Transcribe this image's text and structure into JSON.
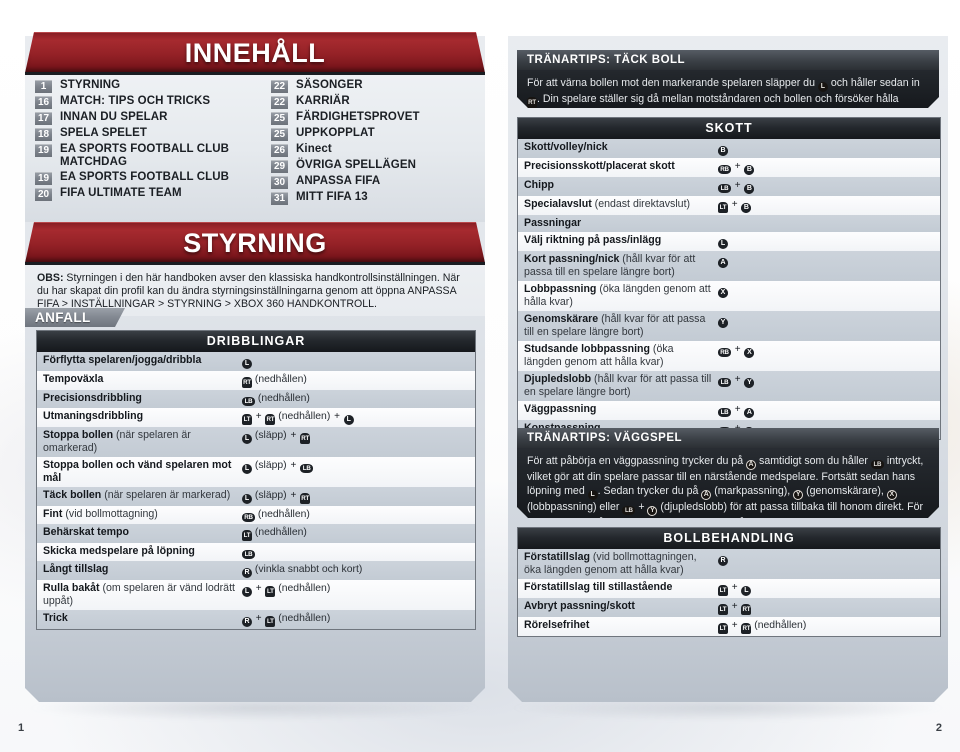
{
  "spread": {
    "page_number_left": "1",
    "page_number_right": "2"
  },
  "left_page": {
    "banner_toc": "INNEHÅLL",
    "banner_section": "STYRNING",
    "toc": {
      "left_column": [
        {
          "page": "1",
          "label": "STYRNING"
        },
        {
          "page": "16",
          "label": "MATCH: TIPS OCH TRICKS"
        },
        {
          "page": "17",
          "label": "INNAN DU SPELAR"
        },
        {
          "page": "18",
          "label": "SPELA SPELET"
        },
        {
          "page": "19",
          "label": "EA SPORTS FOOTBALL CLUB",
          "label2": "MATCHDAG"
        },
        {
          "page": "19",
          "label": "EA SPORTS FOOTBALL CLUB"
        },
        {
          "page": "20",
          "label": "FIFA ULTIMATE TEAM"
        }
      ],
      "right_column": [
        {
          "page": "22",
          "label": "SÄSONGER"
        },
        {
          "page": "22",
          "label": "KARRIÄR"
        },
        {
          "page": "25",
          "label": "FÄRDIGHETSPROVET"
        },
        {
          "page": "25",
          "label": "UPPKOPPLAT"
        },
        {
          "page": "26",
          "label": "Kinect"
        },
        {
          "page": "29",
          "label": "ÖVRIGA SPELLÄGEN"
        },
        {
          "page": "30",
          "label": "ANPASSA FIFA"
        },
        {
          "page": "31",
          "label": "MITT FIFA 13"
        }
      ]
    },
    "note": {
      "prefix": "OBS:",
      "text": " Styrningen i den här handboken avser den klassiska handkontrollsinställningen. När du har skapat din profil kan du ändra styrningsinställningarna genom att öppna ANPASSA FIFA > INSTÄLLNINGAR > STYRNING > XBOX 360 HANDKONTROLL."
    },
    "section_tab": "ANFALL",
    "table": {
      "header": "DRIBBLINGAR",
      "rows": [
        {
          "label": "Förflytta spelaren/jogga/dribbla",
          "note": "",
          "buttons": [
            {
              "t": "stick",
              "k": "L"
            }
          ]
        },
        {
          "label": "Tempoväxla",
          "note": "",
          "buttons": [
            {
              "t": "trigger",
              "k": "RT"
            },
            {
              "t": "text",
              "k": "(nedhållen)"
            }
          ]
        },
        {
          "label": "Precisionsdribbling",
          "note": "",
          "buttons": [
            {
              "t": "shoulder",
              "k": "LB"
            },
            {
              "t": "text",
              "k": "(nedhållen)"
            }
          ]
        },
        {
          "label": "Utmaningsdribbling",
          "note": "",
          "buttons": [
            {
              "t": "trigger",
              "k": "LT"
            },
            {
              "t": "plus"
            },
            {
              "t": "trigger",
              "k": "RT"
            },
            {
              "t": "text",
              "k": "(nedhållen)"
            },
            {
              "t": "plus"
            },
            {
              "t": "stick",
              "k": "L"
            }
          ]
        },
        {
          "label": "Stoppa bollen",
          "note": " (när spelaren är omarkerad)",
          "buttons": [
            {
              "t": "stick",
              "k": "L"
            },
            {
              "t": "text",
              "k": "(släpp)"
            },
            {
              "t": "plus"
            },
            {
              "t": "trigger",
              "k": "RT"
            }
          ]
        },
        {
          "label": "Stoppa bollen och vänd spelaren mot mål",
          "note": "",
          "buttons": [
            {
              "t": "stick",
              "k": "L"
            },
            {
              "t": "text",
              "k": "(släpp)"
            },
            {
              "t": "plus"
            },
            {
              "t": "shoulder",
              "k": "LB"
            }
          ]
        },
        {
          "label": "Täck bollen",
          "note": " (när spelaren är markerad)",
          "buttons": [
            {
              "t": "stick",
              "k": "L"
            },
            {
              "t": "text",
              "k": "(släpp)"
            },
            {
              "t": "plus"
            },
            {
              "t": "trigger",
              "k": "RT"
            }
          ]
        },
        {
          "label": "Fint",
          "note": " (vid bollmottagning)",
          "buttons": [
            {
              "t": "shoulder",
              "k": "RB"
            },
            {
              "t": "text",
              "k": "(nedhållen)"
            }
          ]
        },
        {
          "label": "Behärskat tempo",
          "note": "",
          "buttons": [
            {
              "t": "trigger",
              "k": "LT"
            },
            {
              "t": "text",
              "k": "(nedhållen)"
            }
          ]
        },
        {
          "label": "Skicka medspelare på löpning",
          "note": "",
          "buttons": [
            {
              "t": "shoulder",
              "k": "LB"
            }
          ]
        },
        {
          "label": "Långt tillslag",
          "note": "",
          "buttons": [
            {
              "t": "stick",
              "k": "R"
            },
            {
              "t": "text",
              "k": "(vinkla snabbt och kort)"
            }
          ]
        },
        {
          "label": "Rulla bakåt",
          "note": " (om spelaren är vänd lodrätt uppåt)",
          "buttons": [
            {
              "t": "stick",
              "k": "L"
            },
            {
              "t": "plus"
            },
            {
              "t": "trigger",
              "k": "LT"
            },
            {
              "t": "text",
              "k": "(nedhållen)"
            }
          ]
        },
        {
          "label": "Trick",
          "note": "",
          "buttons": [
            {
              "t": "stick",
              "k": "R"
            },
            {
              "t": "plus"
            },
            {
              "t": "trigger",
              "k": "LT"
            },
            {
              "t": "text",
              "k": "(nedhållen)"
            }
          ]
        }
      ]
    }
  },
  "right_page": {
    "tip_tackboll": {
      "title": "TRÄNARTIPS: TÄCK BOLL",
      "parts": [
        {
          "t": "text",
          "k": "För att värna bollen mot den markerande spelaren släpper du "
        },
        {
          "t": "stick",
          "k": "L"
        },
        {
          "t": "text",
          "k": " och håller sedan in "
        },
        {
          "t": "trigger",
          "k": "RT"
        },
        {
          "t": "text",
          "k": ". Din spelare ställer sig då mellan motståndaren och bollen och försöker hålla undan honom."
        }
      ]
    },
    "tip_vaggspel": {
      "title": "TRÄNARTIPS: VÄGGSPEL",
      "parts": [
        {
          "t": "text",
          "k": "För att påbörja en väggpassning trycker du på "
        },
        {
          "t": "round",
          "k": "A"
        },
        {
          "t": "text",
          "k": " samtidigt som du håller "
        },
        {
          "t": "shoulder",
          "k": "LB"
        },
        {
          "t": "text",
          "k": " intryckt, vilket gör att din spelare passar till en närstående medspelare. Fortsätt sedan hans löpning med "
        },
        {
          "t": "stick",
          "k": "L"
        },
        {
          "t": "text",
          "k": ". Sedan trycker du på "
        },
        {
          "t": "round",
          "k": "A"
        },
        {
          "t": "text",
          "k": " (markpassning), "
        },
        {
          "t": "round",
          "k": "Y"
        },
        {
          "t": "text",
          "k": " (genomskärare), "
        },
        {
          "t": "round",
          "k": "X"
        },
        {
          "t": "text",
          "k": " (lobbpassning) eller "
        },
        {
          "t": "shoulder",
          "k": "LB"
        },
        {
          "t": "text",
          "k": " + "
        },
        {
          "t": "round",
          "k": "Y"
        },
        {
          "t": "text",
          "k": " (djupledslobb) för att passa tillbaka till honom direkt. För att bollen ska gå fram krävs att passningen slås vid exakt rätt tidpunkt."
        }
      ]
    },
    "table_skott": {
      "header": "SKOTT",
      "rows": [
        {
          "label": "Skott/volley/nick",
          "note": "",
          "buttons": [
            {
              "t": "round",
              "k": "B"
            }
          ]
        },
        {
          "label": "Precisionsskott/placerat skott",
          "note": "",
          "buttons": [
            {
              "t": "shoulder",
              "k": "RB"
            },
            {
              "t": "plus"
            },
            {
              "t": "round",
              "k": "B"
            }
          ]
        },
        {
          "label": "Chipp",
          "note": "",
          "buttons": [
            {
              "t": "shoulder",
              "k": "LB"
            },
            {
              "t": "plus"
            },
            {
              "t": "round",
              "k": "B"
            }
          ]
        },
        {
          "label": "Specialavslut",
          "note": " (endast direktavslut)",
          "buttons": [
            {
              "t": "trigger",
              "k": "LT"
            },
            {
              "t": "plus"
            },
            {
              "t": "round",
              "k": "B"
            }
          ]
        },
        {
          "label": "Passningar",
          "note": "",
          "buttons": [],
          "subhead": true
        },
        {
          "label": "Välj riktning på pass/inlägg",
          "note": "",
          "buttons": [
            {
              "t": "stick",
              "k": "L"
            }
          ]
        },
        {
          "label": "Kort passning/nick",
          "note": " (håll kvar för att passa till en spelare längre bort)",
          "buttons": [
            {
              "t": "round",
              "k": "A"
            }
          ]
        },
        {
          "label": "Lobbpassning",
          "note": "\n(öka längden genom att hålla kvar)",
          "buttons": [
            {
              "t": "round",
              "k": "X"
            }
          ]
        },
        {
          "label": "Genomskärare",
          "note": " (håll kvar för att passa till en spelare längre bort)",
          "buttons": [
            {
              "t": "round",
              "k": "Y"
            }
          ]
        },
        {
          "label": "Studsande lobbpassning",
          "note": " (öka längden genom att hålla kvar)",
          "buttons": [
            {
              "t": "shoulder",
              "k": "RB"
            },
            {
              "t": "plus"
            },
            {
              "t": "round",
              "k": "X"
            }
          ]
        },
        {
          "label": "Djupledslobb",
          "note": " (håll kvar för att passa till en spelare längre bort)",
          "buttons": [
            {
              "t": "shoulder",
              "k": "LB"
            },
            {
              "t": "plus"
            },
            {
              "t": "round",
              "k": "Y"
            }
          ]
        },
        {
          "label": "Väggpassning",
          "note": "",
          "buttons": [
            {
              "t": "shoulder",
              "k": "LB"
            },
            {
              "t": "plus"
            },
            {
              "t": "round",
              "k": "A"
            }
          ]
        },
        {
          "label": "Konstpassning",
          "note": "",
          "buttons": [
            {
              "t": "shoulder",
              "k": "RB"
            },
            {
              "t": "plus"
            },
            {
              "t": "round",
              "k": "A"
            }
          ]
        }
      ]
    },
    "table_bollbehandling": {
      "header": "BOLLBEHANDLING",
      "rows": [
        {
          "label": "Förstatillslag",
          "note": " (vid bollmottagningen, öka längden genom att hålla kvar)",
          "buttons": [
            {
              "t": "stick",
              "k": "R"
            }
          ]
        },
        {
          "label": "Förstatillslag till stillastående",
          "note": "",
          "buttons": [
            {
              "t": "trigger",
              "k": "LT"
            },
            {
              "t": "plus"
            },
            {
              "t": "stick",
              "k": "L"
            }
          ]
        },
        {
          "label": "Avbryt passning/skott",
          "note": "",
          "buttons": [
            {
              "t": "trigger",
              "k": "LT"
            },
            {
              "t": "plus"
            },
            {
              "t": "trigger",
              "k": "RT"
            }
          ]
        },
        {
          "label": "Rörelsefrihet",
          "note": "",
          "buttons": [
            {
              "t": "trigger",
              "k": "LT"
            },
            {
              "t": "plus"
            },
            {
              "t": "trigger",
              "k": "RT"
            },
            {
              "t": "text",
              "k": "(nedhållen)"
            }
          ]
        }
      ]
    }
  },
  "colors": {
    "banner_red": "#952227",
    "page_bg": "#dfe4ea",
    "table_header_dark": "#1a1d22",
    "row_odd": "#c8cfd8",
    "row_even": "#f7f9fb",
    "badge_grey": "#7d838c"
  }
}
